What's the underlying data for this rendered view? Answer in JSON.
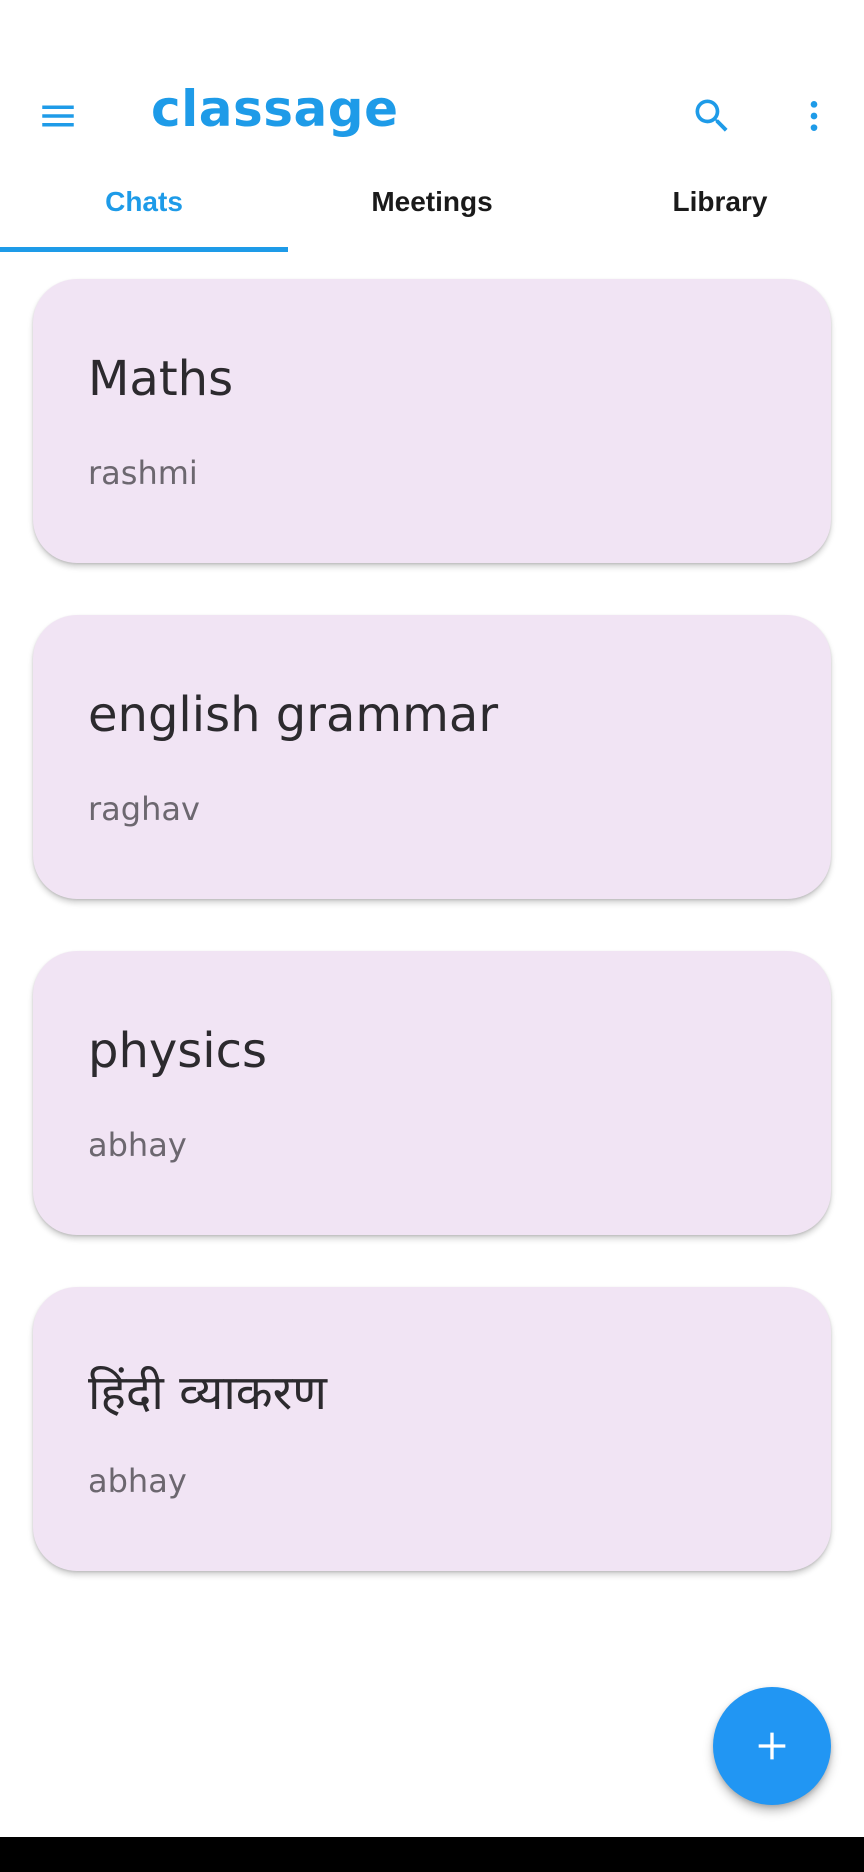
{
  "app": {
    "title": "classage"
  },
  "icons": {
    "menu": "menu-icon",
    "search": "search-icon",
    "more": "more-vert-icon",
    "add": "plus-icon"
  },
  "colors": {
    "accent": "#1e9be8",
    "card_background": "#f1e4f4",
    "fab": "#2196f3"
  },
  "tabs": [
    {
      "label": "Chats",
      "selected": true
    },
    {
      "label": "Meetings",
      "selected": false
    },
    {
      "label": "Library",
      "selected": false
    }
  ],
  "chats": [
    {
      "title": "Maths",
      "subtitle": "rashmi"
    },
    {
      "title": "english grammar",
      "subtitle": "raghav"
    },
    {
      "title": "physics",
      "subtitle": "abhay"
    },
    {
      "title": "हिंदी व्याकरण",
      "subtitle": "abhay"
    }
  ]
}
